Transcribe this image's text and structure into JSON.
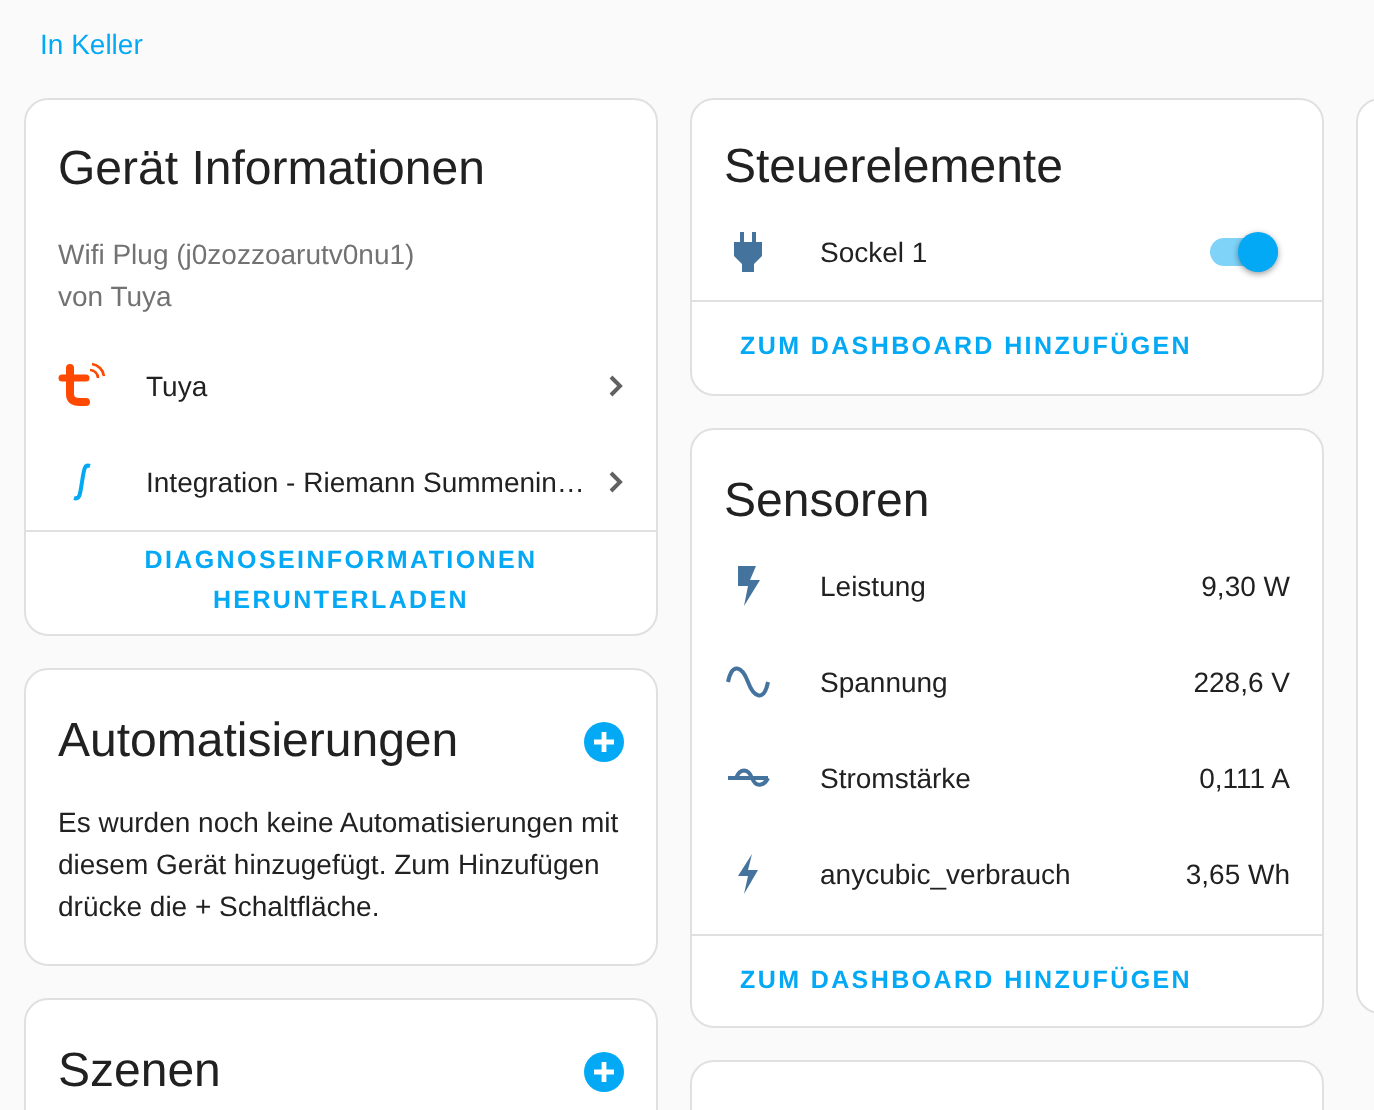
{
  "breadcrumb": {
    "label": "In Keller"
  },
  "device_info": {
    "title": "Gerät Informationen",
    "model": "Wifi Plug (j0zozzoarutv0nu1)",
    "manufacturer": "von Tuya",
    "integrations": [
      {
        "kind": "tuya",
        "label": "Tuya"
      },
      {
        "kind": "integral",
        "label": "Integration - Riemann Summenin…"
      }
    ],
    "action": "DIAGNOSEINFORMATIONEN HERUNTERLADEN"
  },
  "automations": {
    "title": "Automatisierungen",
    "text": "Es wurden noch keine Automatisierungen mit diesem Gerät hinzugefügt. Zum Hinzufügen drücke die + Schaltfläche."
  },
  "scenes": {
    "title": "Szenen"
  },
  "controls": {
    "title": "Steuerelemente",
    "items": [
      {
        "label": "Sockel 1",
        "on": true
      }
    ],
    "action": "ZUM DASHBOARD HINZUFÜGEN"
  },
  "sensors": {
    "title": "Sensoren",
    "items": [
      {
        "kind": "power",
        "label": "Leistung",
        "value": "9,30 W"
      },
      {
        "kind": "voltage",
        "label": "Spannung",
        "value": "228,6 V"
      },
      {
        "kind": "current",
        "label": "Stromstärke",
        "value": "0,111 A"
      },
      {
        "kind": "energy",
        "label": "anycubic_verbrauch",
        "value": "3,65 Wh"
      }
    ],
    "action": "ZUM DASHBOARD HINZUFÜGEN"
  }
}
